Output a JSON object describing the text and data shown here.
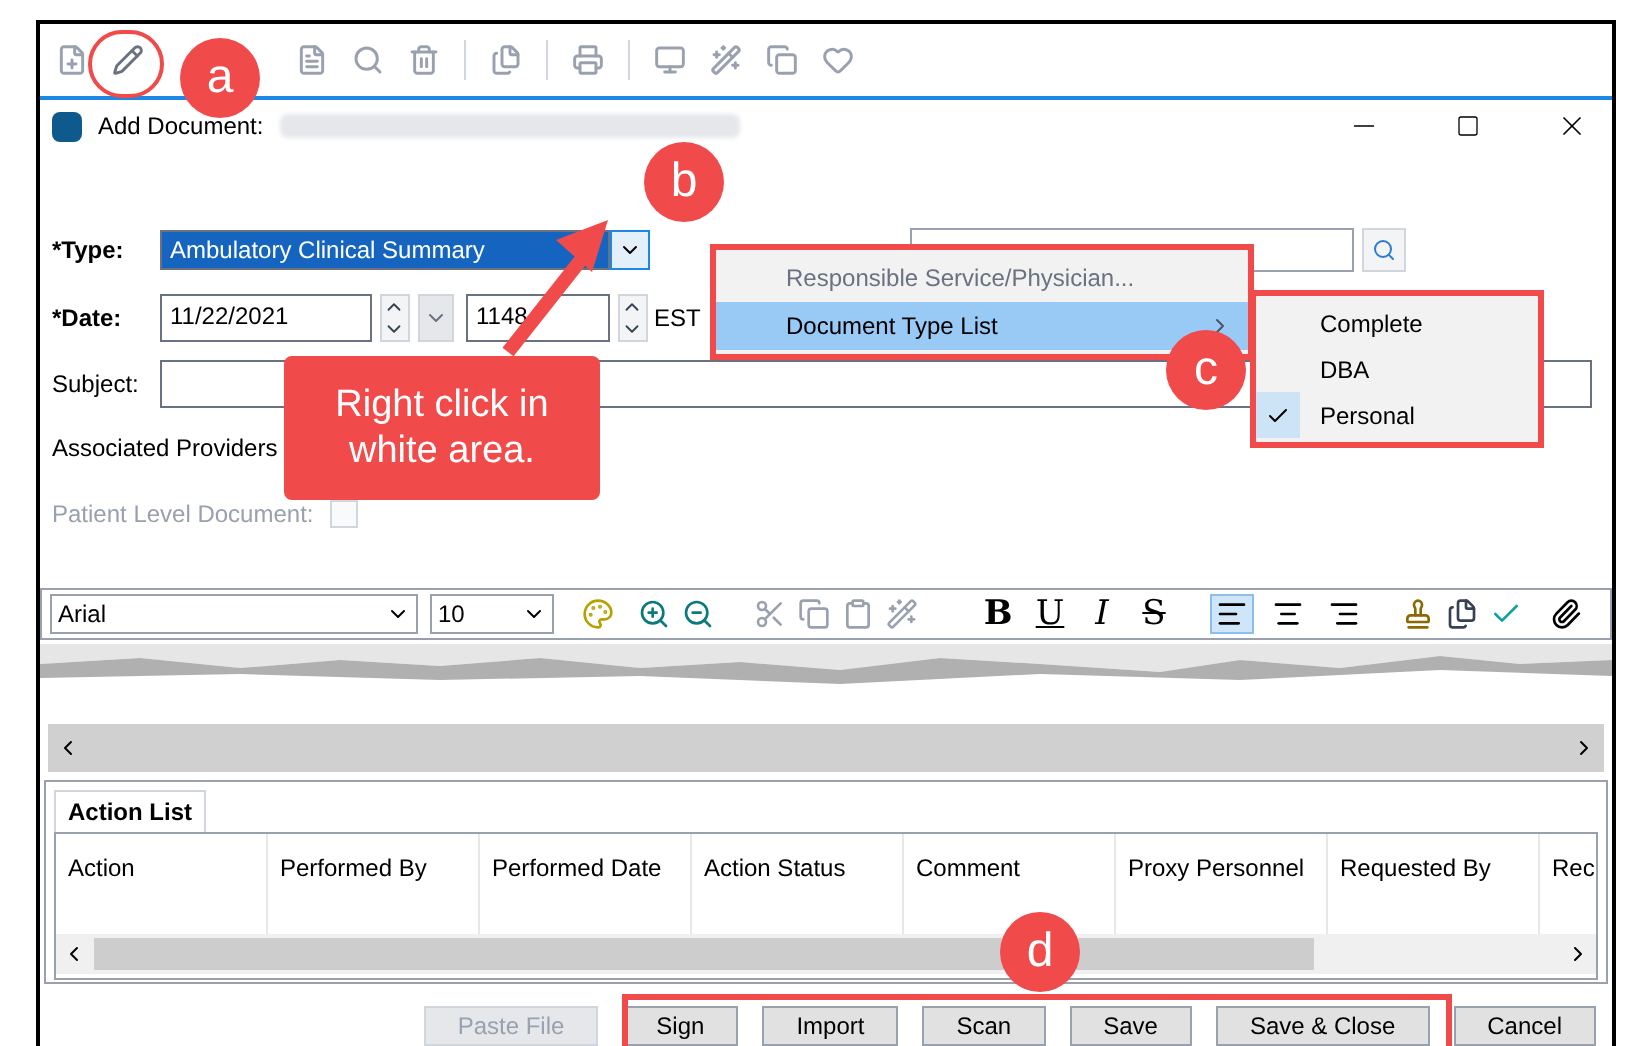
{
  "window": {
    "title": "Add Document:"
  },
  "form": {
    "type": {
      "label": "*Type:",
      "value": "Ambulatory Clinical Summary"
    },
    "date": {
      "label": "*Date:",
      "value": "11/22/2021",
      "time": "1148",
      "zone": "EST"
    },
    "subject": {
      "label": "Subject:"
    },
    "associated_providers": {
      "label": "Associated Providers"
    },
    "patient_level": {
      "label": "Patient Level Document:",
      "checked": false,
      "disabled": true
    }
  },
  "editor": {
    "font": "Arial",
    "size": "10",
    "format_buttons": [
      {
        "label": "B",
        "kind": "bold"
      },
      {
        "label": "U",
        "kind": "underline"
      },
      {
        "label": "I",
        "kind": "italic"
      },
      {
        "label": "S",
        "kind": "strike"
      }
    ],
    "align_buttons": [
      {
        "kind": "left",
        "selected": true
      },
      {
        "kind": "center",
        "selected": false
      },
      {
        "kind": "right",
        "selected": false
      }
    ]
  },
  "action_list": {
    "tab": "Action List",
    "columns": [
      "Action",
      "Performed By",
      "Performed Date",
      "Action Status",
      "Comment",
      "Proxy Personnel",
      "Requested By",
      "Rec"
    ]
  },
  "buttons": [
    {
      "label": "Paste File",
      "disabled": true
    },
    {
      "label": "Sign",
      "disabled": false
    },
    {
      "label": "Import",
      "disabled": false
    },
    {
      "label": "Scan",
      "disabled": false
    },
    {
      "label": "Save",
      "disabled": false
    },
    {
      "label": "Save & Close",
      "disabled": false
    },
    {
      "label": "Cancel",
      "disabled": false
    }
  ],
  "context_menu": {
    "items": [
      {
        "label": "Responsible Service/Physician...",
        "disabled": true,
        "selected": false,
        "submenu": false
      },
      {
        "label": "Document Type List",
        "disabled": false,
        "selected": true,
        "submenu": true
      }
    ]
  },
  "submenu": {
    "items": [
      {
        "label": "Complete",
        "checked": false
      },
      {
        "label": "DBA",
        "checked": false
      },
      {
        "label": "Personal",
        "checked": true
      }
    ]
  },
  "annotations": {
    "markers": [
      "a",
      "b",
      "c",
      "d"
    ],
    "callout": "Right click in white area."
  }
}
